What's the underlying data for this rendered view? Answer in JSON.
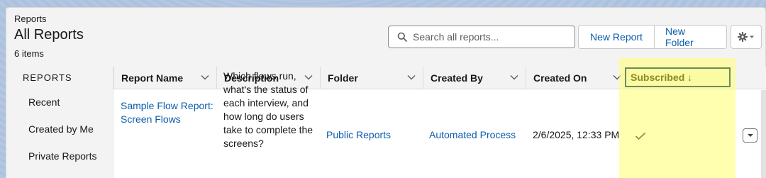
{
  "header": {
    "breadcrumb": "Reports",
    "title": "All Reports",
    "item_count": "6 items",
    "search_placeholder": "Search all reports...",
    "new_report_label": "New Report",
    "new_folder_label": "New Folder"
  },
  "sidebar": {
    "heading": "REPORTS",
    "items": [
      {
        "label": "Recent"
      },
      {
        "label": "Created by Me"
      },
      {
        "label": "Private Reports"
      }
    ]
  },
  "table": {
    "columns": [
      "Report Name",
      "Description",
      "Folder",
      "Created By",
      "Created On",
      "Subscribed ↓"
    ],
    "rows": [
      {
        "report_name": [
          "Sample Flow Report:",
          "Screen Flows"
        ],
        "description": [
          "Which flows run,",
          "what's the status of",
          "each interview, and",
          "how long do users",
          "take to complete the",
          "screens?"
        ],
        "folder": "Public Reports",
        "created_by": "Automated Process",
        "created_on": "2/6/2025, 12:33 PM",
        "subscribed": "✓"
      }
    ]
  },
  "colors": {
    "link": "#0b5cab",
    "highlight": "#ffff6e"
  },
  "icons": [
    "search-icon",
    "gear-icon",
    "chevron-down-icon",
    "checkmark-icon"
  ]
}
